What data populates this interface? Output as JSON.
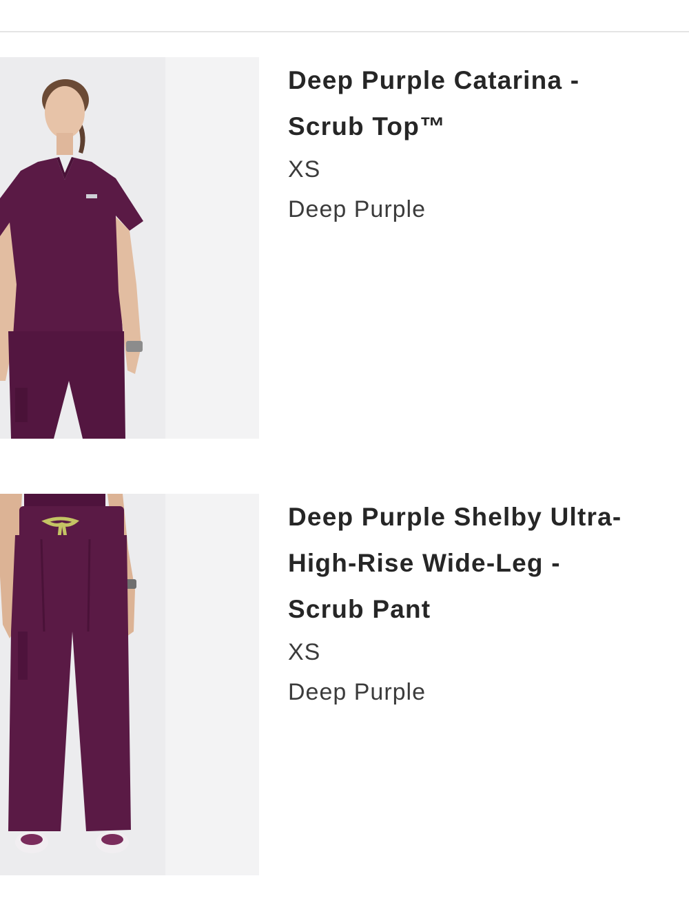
{
  "cart": {
    "items": [
      {
        "title": "Deep Purple Catarina - Scrub Top™",
        "title_line1": "Deep Purple Catarina -",
        "title_line2": "Scrub Top™",
        "size": "XS",
        "color_name": "Deep Purple",
        "image": "woman-in-purple-scrub-top-photo"
      },
      {
        "title": "Deep Purple Shelby Ultra-High-Rise Wide-Leg - Scrub Pant",
        "title_line1": "Deep Purple Shelby Ultra-",
        "title_line2": "High-Rise Wide-Leg -",
        "title_line3": "Scrub Pant",
        "size": "XS",
        "color_name": "Deep Purple",
        "image": "purple-wide-leg-scrub-pant-photo"
      }
    ]
  },
  "colors": {
    "garment": "#5a1a45",
    "background": "#ffffff",
    "text": "#262626",
    "divider": "#e4e4e4"
  }
}
